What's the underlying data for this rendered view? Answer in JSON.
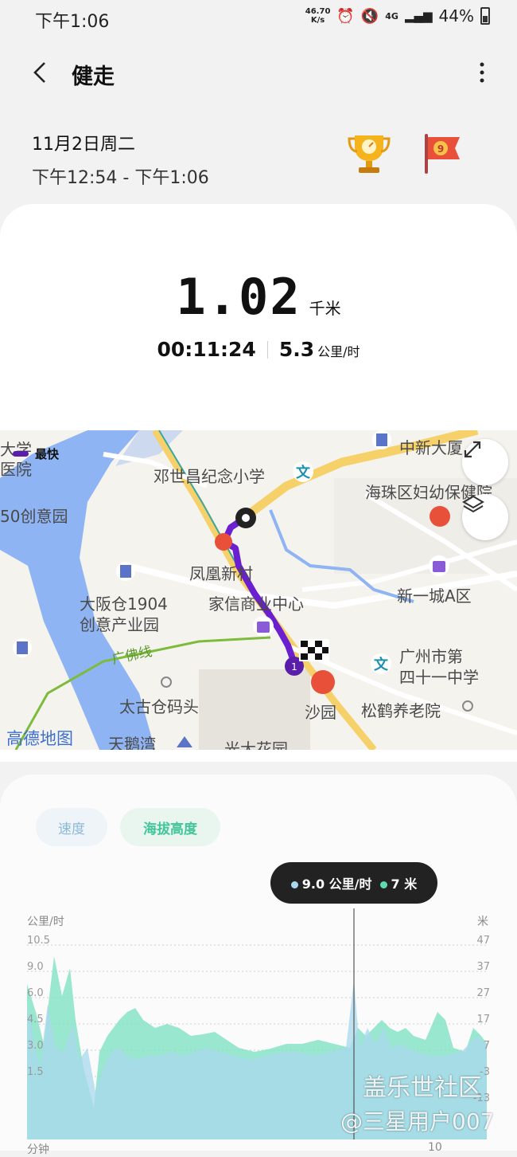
{
  "status": {
    "time": "下午1:06",
    "netspeed_value": "46.70",
    "netspeed_unit": "K/s",
    "signal": "4G",
    "battery": "44%"
  },
  "header": {
    "title": "健走"
  },
  "session": {
    "date": "11月2日周二",
    "time_range": "下午12:54 - 下午1:06"
  },
  "summary": {
    "distance": "1.02",
    "distance_unit": "千米",
    "duration": "00:11:24",
    "speed": "5.3",
    "speed_unit": "公里/时"
  },
  "map": {
    "legend_label": "最快",
    "labels": [
      "大学",
      "医院",
      "50创意园",
      "邓世昌纪念小学",
      "中新大厦",
      "海珠区妇幼保健院",
      "凤凰新村",
      "大阪仓1904",
      "创意产业园",
      "家信商业中心",
      "新一城A区",
      "广佛线",
      "广州市第",
      "四十一中学",
      "太古仓码头",
      "沙园",
      "松鹤养老院",
      "天鹅湾",
      "光大花园",
      "高德地图"
    ],
    "colors": {
      "route": "#6a1fd0",
      "water": "#8fb4f4",
      "road_major": "#f6d068"
    }
  },
  "chart_tabs": {
    "speed": "速度",
    "altitude": "海拔高度"
  },
  "tooltip": {
    "speed": "9.0 公里/时",
    "altitude": "7 米"
  },
  "chart_data": {
    "type": "area",
    "left_axis_label": "公里/时",
    "right_axis_label": "米",
    "left_ticks": [
      "10.5",
      "9.0",
      "6.0",
      "4.5",
      "3.0",
      "1.5"
    ],
    "right_ticks": [
      "47",
      "37",
      "27",
      "17",
      "7",
      "-3",
      "-13"
    ],
    "x_label": "分钟",
    "x_tick_end": "10",
    "series": [
      {
        "name": "速度",
        "color": "#a9d8ee"
      },
      {
        "name": "海拔高度",
        "color": "#86e3c6"
      }
    ]
  },
  "watermark": {
    "line1": "盖乐世社区",
    "line2": "@三星用户007"
  }
}
